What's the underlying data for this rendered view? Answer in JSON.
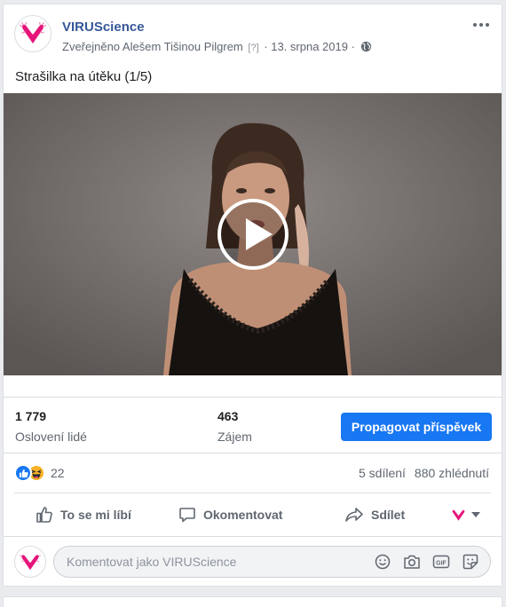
{
  "post": {
    "page_name": "VIRUScience",
    "meta_published_by": "Zveřejněno Alešem Tišinou Pilgrem",
    "meta_question": "[?]",
    "meta_date": "13. srpna 2019",
    "text": "Strašilka na útěku (1/5)"
  },
  "insights": {
    "reach_value": "1 779",
    "reach_label": "Oslovení lidé",
    "engagement_value": "463",
    "engagement_label": "Zájem",
    "promote_label": "Propagovat příspěvek"
  },
  "reactions": {
    "count": "22",
    "shares": "5 sdílení",
    "views": "880 zhlédnutí"
  },
  "actions": {
    "like_label": "To se mi líbí",
    "comment_label": "Okomentovat",
    "share_label": "Sdílet"
  },
  "composer": {
    "placeholder": "Komentovat jako VIRUScience"
  },
  "icons": [
    "virus-logo-icon",
    "globe-icon",
    "more-options-icon",
    "play-icon",
    "like-reaction-icon",
    "haha-reaction-icon",
    "thumbs-up-icon",
    "comment-icon",
    "share-icon",
    "emoji-icon",
    "camera-icon",
    "gif-icon",
    "sticker-icon",
    "chevron-down-icon"
  ],
  "colors": {
    "accent": "#1877f2",
    "page_name": "#365899",
    "brand": "#e6157a"
  }
}
